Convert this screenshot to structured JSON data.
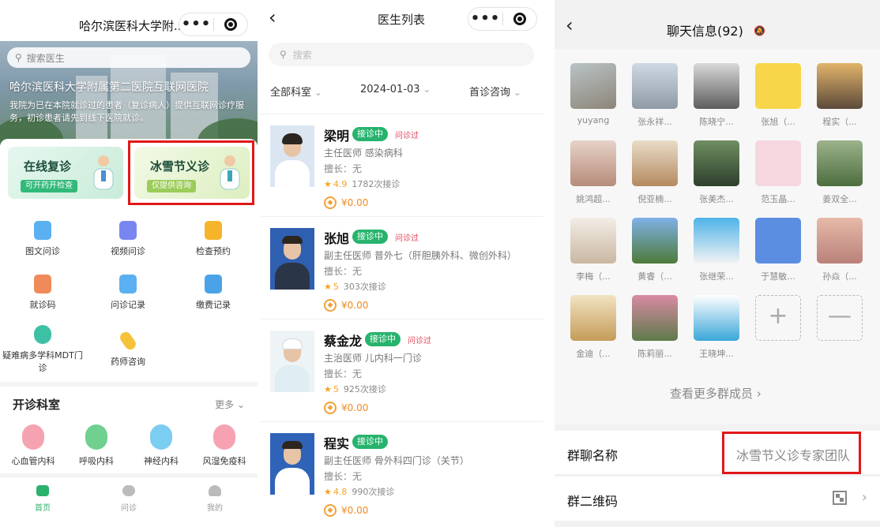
{
  "panel1": {
    "title": "哈尔滨医科大学附...",
    "search_placeholder": "搜索医生",
    "hero_title": "哈尔滨医科大学附属第二医院互联网医院",
    "hero_desc": "我院为已在本院就诊过的患者（复诊病人）提供互联网诊疗服务，初诊患者请先到线下医院就诊。",
    "card_online": {
      "title": "在线复诊",
      "tag": "可开药开检查"
    },
    "card_free": {
      "title": "冰雪节义诊",
      "tag": "仅提供咨询"
    },
    "services": [
      "图文问诊",
      "视频问诊",
      "检查预约",
      "就诊码",
      "问诊记录",
      "缴费记录",
      "疑难病多学科MDT门诊",
      "药师咨询"
    ],
    "dept_title": "开诊科室",
    "dept_more": "更多",
    "departments": [
      "心血管内科",
      "呼吸内科",
      "神经内科",
      "风湿免疫科"
    ],
    "tabs": [
      "首页",
      "问诊",
      "我的"
    ]
  },
  "panel2": {
    "title": "医生列表",
    "search_placeholder": "搜索",
    "filters": [
      "全部科室",
      "2024-01-03",
      "首诊咨询"
    ],
    "doctors": [
      {
        "name": "梁明",
        "status": "接诊中",
        "tag": "问诊过",
        "title": "主任医师 感染病科",
        "spec": "擅长：无",
        "rating": "4.9",
        "count": "1782次接诊",
        "price": "¥0.00"
      },
      {
        "name": "张旭",
        "status": "接诊中",
        "tag": "问诊过",
        "title": "副主任医师 普外七（肝胆胰外科、微创外科）",
        "spec": "擅长：无",
        "rating": "5",
        "count": "303次接诊",
        "price": "¥0.00"
      },
      {
        "name": "蔡金龙",
        "status": "接诊中",
        "tag": "问诊过",
        "title": "主治医师 儿内科一门诊",
        "spec": "擅长：无",
        "rating": "5",
        "count": "925次接诊",
        "price": "¥0.00"
      },
      {
        "name": "程实",
        "status": "接诊中",
        "tag": "",
        "title": "副主任医师 骨外科四门诊（关节）",
        "spec": "擅长：无",
        "rating": "4.8",
        "count": "990次接诊",
        "price": "¥0.00"
      }
    ]
  },
  "panel3": {
    "title": "聊天信息(92)",
    "members": [
      "yuyang",
      "张永祥...",
      "陈晓宁...",
      "张旭（...",
      "程实（...",
      "姚鸿超...",
      "倪亚楠...",
      "张美杰...",
      "范玉晶...",
      "姜双全...",
      "李梅（...",
      "黄睿（...",
      "张继荣...",
      "于慧敏...",
      "孙焱（...",
      "金迪（...",
      "陈莉丽...",
      "王晓坤..."
    ],
    "add_symbol": "+",
    "remove_symbol": "—",
    "more_members": "查看更多群成员 ›",
    "group_name_label": "群聊名称",
    "group_name_value": "冰雪节义诊专家团队",
    "qr_label": "群二维码"
  },
  "colors": {
    "accent_green": "#27b36d",
    "highlight_red": "#e01818",
    "price_orange": "#f08a24"
  }
}
